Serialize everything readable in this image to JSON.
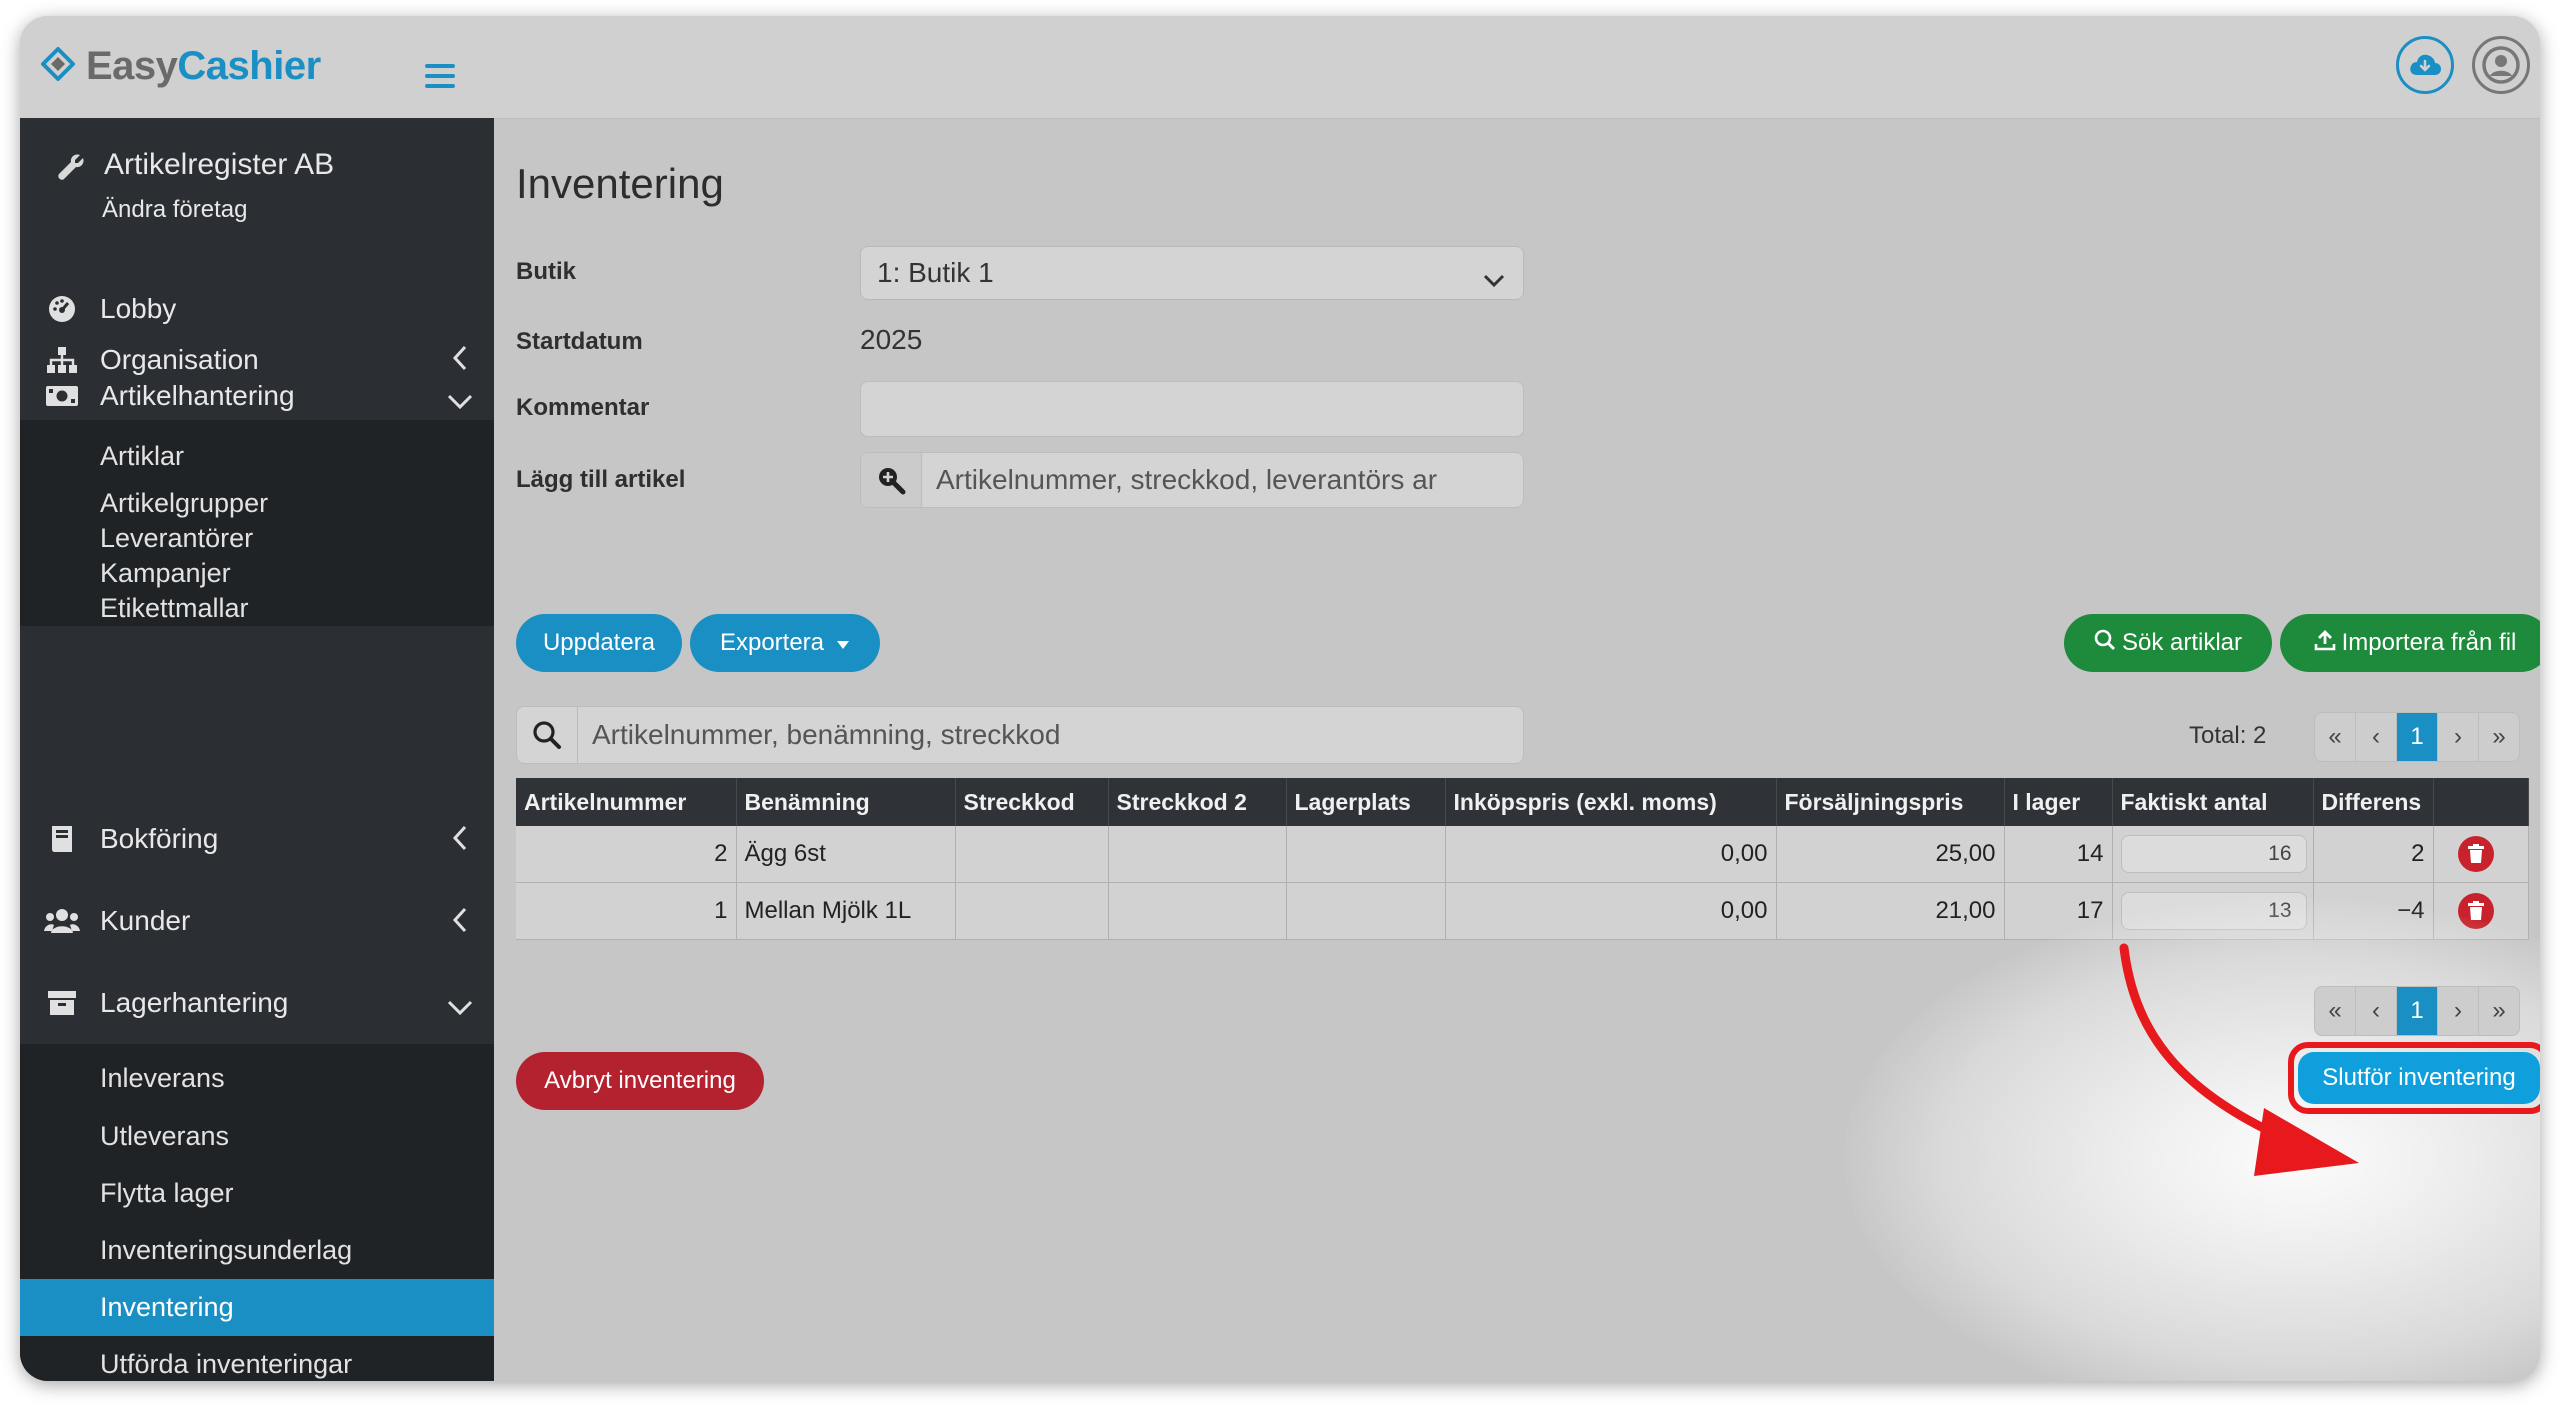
{
  "app": {
    "brand_part1": "Easy",
    "brand_part2": "Cashier",
    "accent_color": "#1a8fc4"
  },
  "header": {
    "icons": [
      "menu-icon",
      "cloud-download-icon",
      "user-account-icon"
    ]
  },
  "sidebar": {
    "company_name": "Artikelregister AB",
    "change_company": "Ändra företag",
    "items": [
      {
        "label": "Lobby",
        "icon": "dashboard-icon"
      },
      {
        "label": "Organisation",
        "icon": "org-chart-icon"
      },
      {
        "label": "Artikelhantering",
        "icon": "money-icon"
      },
      {
        "label": "Bokföring",
        "icon": "book-icon"
      },
      {
        "label": "Kunder",
        "icon": "users-icon"
      },
      {
        "label": "Lagerhantering",
        "icon": "archive-icon"
      }
    ],
    "artikel_sub": [
      "Artiklar",
      "Artikelgrupper",
      "Leverantörer",
      "Kampanjer",
      "Etikettmallar"
    ],
    "lager_sub": [
      "Inleverans",
      "Utleverans",
      "Flytta lager",
      "Inventeringsunderlag",
      "Inventering",
      "Utförda inventeringar"
    ],
    "active_item": "Inventering"
  },
  "page": {
    "title": "Inventering",
    "labels": {
      "butik": "Butik",
      "startdatum": "Startdatum",
      "kommentar": "Kommentar",
      "lagg_till": "Lägg till artikel"
    },
    "butik_value": "1: Butik 1",
    "startdatum_value": "2025",
    "kommentar_value": "",
    "add_article_placeholder": "Artikelnummer, streckkod, leverantörs ar",
    "buttons": {
      "uppdatera": "Uppdatera",
      "exportera": "Exportera",
      "sok_artiklar": "Sök artiklar",
      "importera": "Importera från fil",
      "avbryt": "Avbryt inventering",
      "slutfor": "Slutför inventering"
    },
    "search_placeholder": "Artikelnummer, benämning, streckkod",
    "total": "Total: 2",
    "pagination": {
      "current": "1"
    },
    "table": {
      "headers": [
        "Artikelnummer",
        "Benämning",
        "Streckkod",
        "Streckkod 2",
        "Lagerplats",
        "Inköpspris (exkl. moms)",
        "Försäljningspris",
        "I lager",
        "Faktiskt antal",
        "Differens"
      ],
      "rows": [
        {
          "artikelnummer": "2",
          "benamning": "Ägg 6st",
          "streckkod": "",
          "streckkod2": "",
          "lagerplats": "",
          "inkopspris": "0,00",
          "forsaljningspris": "25,00",
          "i_lager": "14",
          "faktiskt": "16",
          "differens": "2"
        },
        {
          "artikelnummer": "1",
          "benamning": "Mellan Mjölk 1L",
          "streckkod": "",
          "streckkod2": "",
          "lagerplats": "",
          "inkopspris": "0,00",
          "forsaljningspris": "21,00",
          "i_lager": "17",
          "faktiskt": "13",
          "differens": "−4"
        }
      ]
    }
  }
}
